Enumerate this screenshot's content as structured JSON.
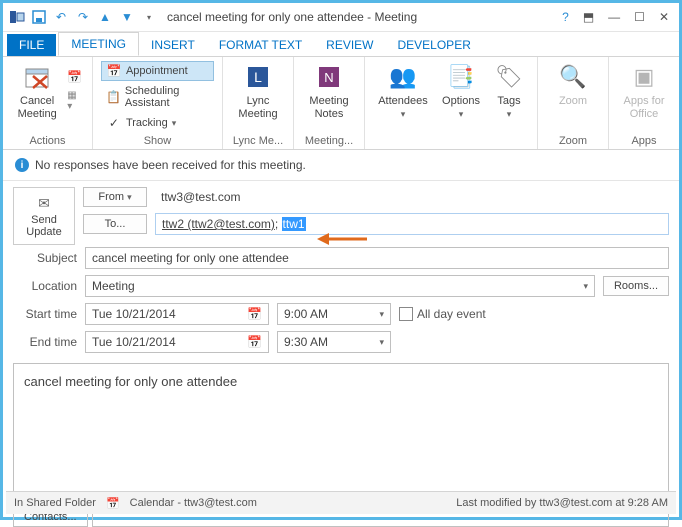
{
  "titlebar": {
    "title": "cancel meeting for only one attendee - Meeting"
  },
  "tabs": {
    "file": "FILE",
    "meeting": "MEETING",
    "insert": "INSERT",
    "format": "FORMAT TEXT",
    "review": "REVIEW",
    "developer": "DEVELOPER"
  },
  "ribbon": {
    "actions": {
      "cancel": "Cancel\nMeeting",
      "label": "Actions"
    },
    "show": {
      "appointment": "Appointment",
      "scheduling": "Scheduling Assistant",
      "tracking": "Tracking",
      "label": "Show"
    },
    "lync": {
      "btn": "Lync\nMeeting",
      "label": "Lync Me..."
    },
    "notes": {
      "btn": "Meeting\nNotes",
      "label": "Meeting..."
    },
    "attendees": {
      "btn": "Attendees",
      "options_btn": "Options",
      "tags_btn": "Tags",
      "label": ""
    },
    "zoom": {
      "btn": "Zoom",
      "label": "Zoom"
    },
    "apps": {
      "btn": "Apps for\nOffice",
      "label": "Apps"
    }
  },
  "info": "No responses have been received for this meeting.",
  "send": "Send\nUpdate",
  "form": {
    "from_label": "From",
    "from_value": "ttw3@test.com",
    "to_btn": "To...",
    "to_v1": "ttw2 (ttw2@test.com)",
    "to_sep": "; ",
    "to_v2": "ttw1",
    "subject_label": "Subject",
    "subject_value": "cancel meeting for only one attendee",
    "location_label": "Location",
    "location_value": "Meeting",
    "rooms_btn": "Rooms...",
    "start_label": "Start time",
    "start_date": "Tue 10/21/2014",
    "start_time": "9:00 AM",
    "allday_label": "All day event",
    "end_label": "End time",
    "end_date": "Tue 10/21/2014",
    "end_time": "9:30 AM"
  },
  "body": "cancel meeting for only one attendee",
  "contacts_btn": "Contacts...",
  "status": {
    "left": "In Shared Folder",
    "mid": "Calendar - ttw3@test.com",
    "right": "Last modified by ttw3@test.com at 9:28 AM"
  }
}
